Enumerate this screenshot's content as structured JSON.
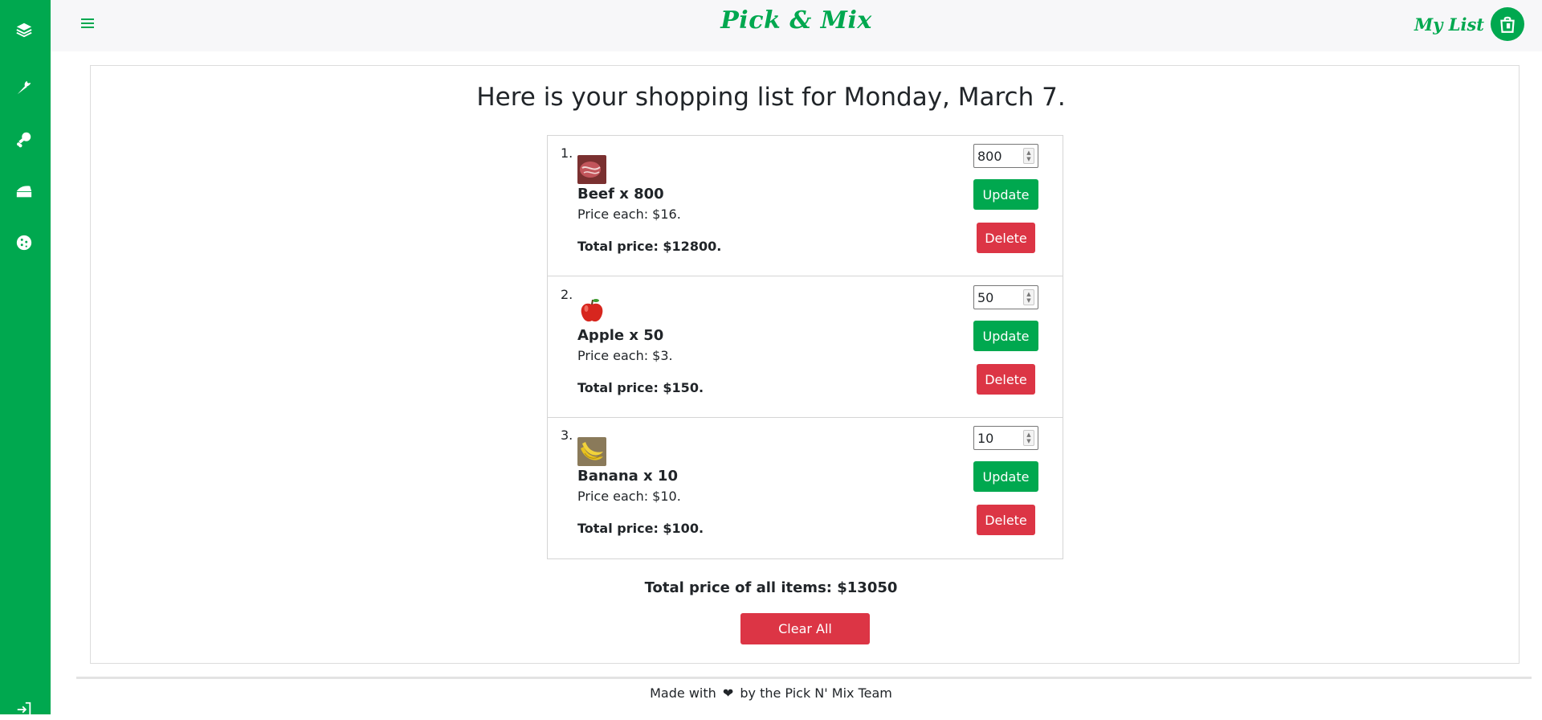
{
  "app": {
    "brand": "Pick & Mix",
    "my_list_label": "My List"
  },
  "sidebar": {
    "items": [
      {
        "icon": "layers-icon"
      },
      {
        "icon": "carrot-icon"
      },
      {
        "icon": "drumstick-icon"
      },
      {
        "icon": "cheese-icon"
      },
      {
        "icon": "cookie-icon"
      },
      {
        "icon": "logout-icon"
      }
    ]
  },
  "main": {
    "title": "Here is your shopping list for Monday, March 7.",
    "items": [
      {
        "number": "1.",
        "name": "Beef x 800",
        "price_each": "Price each: $16.",
        "total": "Total price: $12800.",
        "quantity": "800",
        "update_label": "Update",
        "delete_label": "Delete"
      },
      {
        "number": "2.",
        "name": "Apple x 50",
        "price_each": "Price each: $3.",
        "total": "Total price: $150.",
        "quantity": "50",
        "update_label": "Update",
        "delete_label": "Delete"
      },
      {
        "number": "3.",
        "name": "Banana x 10",
        "price_each": "Price each: $10.",
        "total": "Total price: $100.",
        "quantity": "10",
        "update_label": "Update",
        "delete_label": "Delete"
      }
    ],
    "grand_total": "Total price of all items: $13050",
    "clear_all_label": "Clear All"
  },
  "footer": {
    "text_before": "Made with",
    "text_after": "by the Pick N' Mix Team"
  },
  "colors": {
    "brand_green": "#00a84f",
    "danger_red": "#dc3545"
  }
}
